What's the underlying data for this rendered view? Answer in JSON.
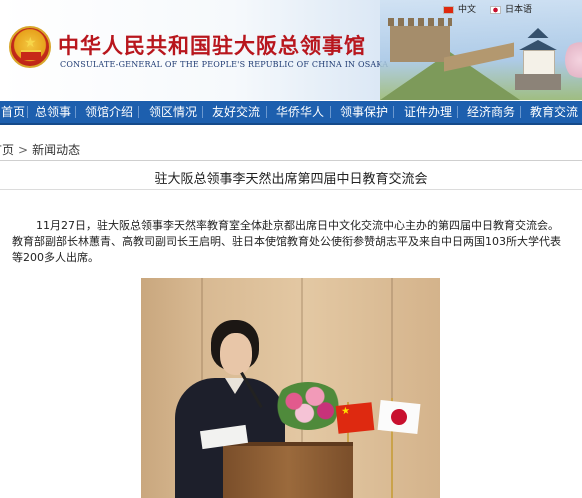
{
  "header": {
    "title_cn": "中华人民共和国驻大阪总领事馆",
    "title_en": "CONSULATE-GENERAL OF THE PEOPLE'S REPUBLIC OF CHINA IN OSAKA",
    "languages": [
      {
        "label": "中文",
        "flag_icon": "china-flag-icon"
      },
      {
        "label": "日本语",
        "flag_icon": "japan-flag-icon"
      }
    ]
  },
  "nav": {
    "items": [
      "首页",
      "总领事",
      "领馆介绍",
      "领区情况",
      "友好交流",
      "华侨华人",
      "领事保护",
      "证件办理",
      "经济商务",
      "教育交流"
    ],
    "background": "#1d5fae"
  },
  "breadcrumb": {
    "home": "首页",
    "separator": ">",
    "current": "新闻动态"
  },
  "article": {
    "title": "驻大阪总领事李天然出席第四届中日教育交流会",
    "body": "11月27日，驻大阪总领事李天然率教育室全体赴京都出席日中文化交流中心主办的第四届中日教育交流会。教育部副部长林蕙青、高教司副司长王启明、驻日本使馆教育处公使衔参赞胡志平及来自中日两国103所大学代表等200多人出席。"
  },
  "photo": {
    "description_icon": "speaker-at-podium-photo"
  },
  "colors": {
    "brand_red": "#b8161d",
    "nav_blue": "#1d5fae"
  }
}
